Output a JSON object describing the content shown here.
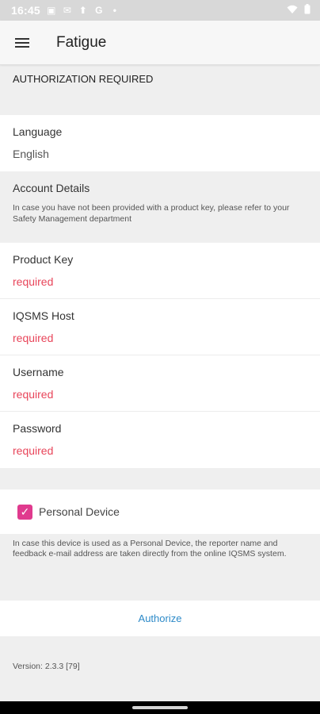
{
  "status_bar": {
    "time": "16:45",
    "left_icons": [
      "image-icon",
      "mail-icon",
      "usb-icon",
      "google-icon",
      "dot-icon"
    ],
    "right_icons": [
      "wifi-icon",
      "battery-icon"
    ]
  },
  "app_bar": {
    "title": "Fatigue"
  },
  "auth_header": "AUTHORIZATION REQUIRED",
  "language": {
    "label": "Language",
    "value": "English"
  },
  "account": {
    "title": "Account Details",
    "note": "In case you have not been provided with a product key, please refer to your Safety Management department"
  },
  "fields": [
    {
      "label": "Product Key",
      "value": "required"
    },
    {
      "label": "IQSMS Host",
      "value": "required"
    },
    {
      "label": "Username",
      "value": "required"
    },
    {
      "label": "Password",
      "value": "required"
    }
  ],
  "personal_device": {
    "label": "Personal Device",
    "checked": true,
    "info": "In case this device is used as a Personal Device, the reporter name and feedback e-mail address are taken directly from the online IQSMS system."
  },
  "authorize": {
    "label": "Authorize"
  },
  "version": "Version: 2.3.3 [79]",
  "colors": {
    "required": "#e8455a",
    "accent": "#e03a8e",
    "link": "#2d8ac8"
  }
}
